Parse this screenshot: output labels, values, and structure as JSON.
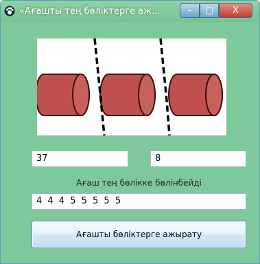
{
  "window": {
    "title": "«Ағашты тең бөліктерге аж...",
    "minimize_glyph": "–",
    "maximize_glyph": "□",
    "close_glyph": "X",
    "app_icon": "paw-icon"
  },
  "picture": {
    "description_icon": "log-cutting-diagram",
    "log_color": "#c0504d"
  },
  "fields": {
    "length_value": "37",
    "parts_value": "8",
    "result_value": "4 4 4 5 5 5 5 5"
  },
  "status": {
    "message": "Ағаш тең бөлікке бөлінбейді"
  },
  "actions": {
    "split_button_label": "Ағашты бөліктерге ажырату"
  }
}
